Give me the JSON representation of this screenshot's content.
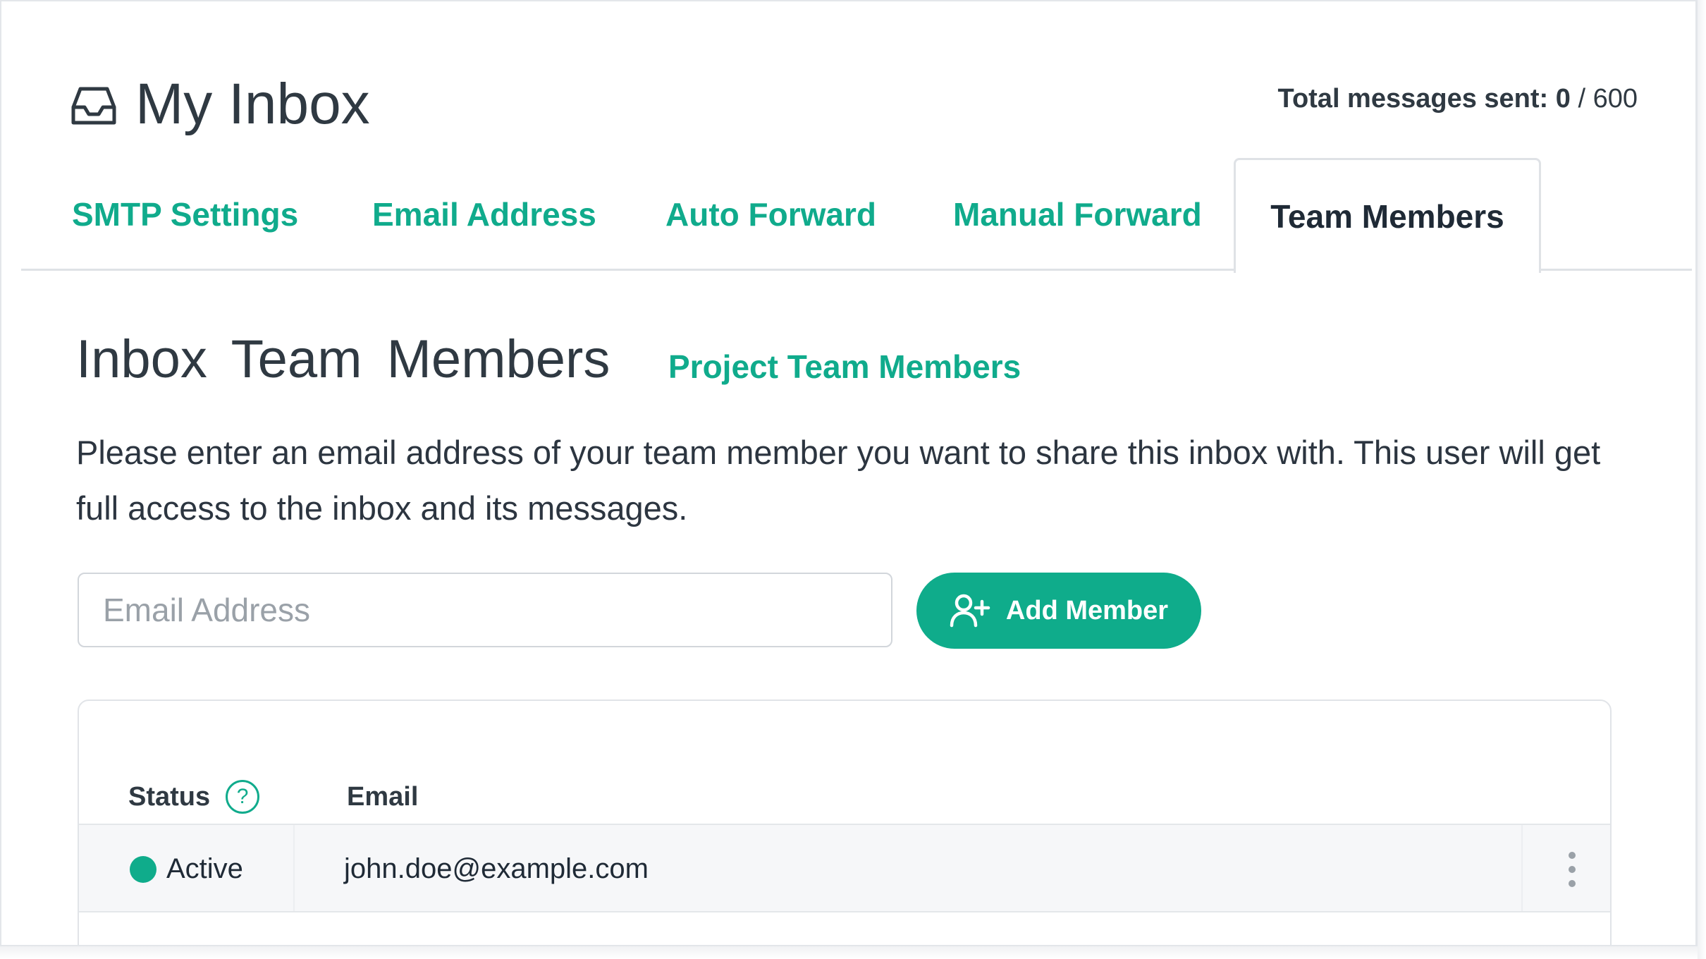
{
  "header": {
    "title": "My Inbox",
    "usage_label": "Total messages sent:",
    "usage_sent": "0",
    "usage_separator": " / ",
    "usage_limit": "600"
  },
  "tabs": [
    {
      "label": "SMTP Settings",
      "active": false
    },
    {
      "label": "Email Address",
      "active": false
    },
    {
      "label": "Auto Forward",
      "active": false
    },
    {
      "label": "Manual Forward",
      "active": false
    },
    {
      "label": "Team Members",
      "active": true
    }
  ],
  "section": {
    "title": "Inbox Team  Members",
    "link": "Project Team Members",
    "description": "Please enter an email address of your team member you want to share this inbox with. This user will get full access to the inbox and its messages."
  },
  "form": {
    "email_placeholder": "Email Address",
    "email_value": "",
    "add_button_label": "Add Member"
  },
  "table": {
    "columns": [
      "Status",
      "Email"
    ],
    "help_glyph": "?",
    "rows": [
      {
        "status": "Active",
        "email": "john.doe@example.com"
      }
    ]
  },
  "colors": {
    "accent": "#0fac8b",
    "text_dark": "#2f3942",
    "border": "#dfe2e6"
  },
  "icons": {
    "header": "inbox-tray-icon",
    "add_button": "user-plus-icon",
    "help": "question-circle-icon",
    "row_menu": "kebab-menu-icon"
  }
}
